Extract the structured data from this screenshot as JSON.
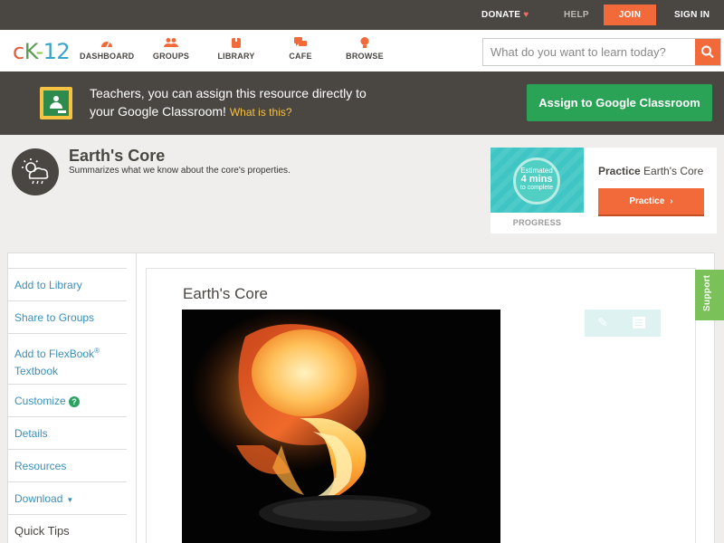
{
  "topbar": {
    "donate": "DONATE",
    "help": "HELP",
    "join": "JOIN",
    "sign_in": "SIGN IN"
  },
  "logo": {
    "c": "c",
    "k": "K",
    "dash": "-",
    "n": "12"
  },
  "nav": {
    "items": [
      {
        "label": "DASHBOARD",
        "icon": "dashboard-icon"
      },
      {
        "label": "GROUPS",
        "icon": "groups-icon"
      },
      {
        "label": "LIBRARY",
        "icon": "library-icon"
      },
      {
        "label": "CAFE",
        "icon": "cafe-icon"
      },
      {
        "label": "BROWSE",
        "icon": "browse-icon"
      }
    ],
    "search_placeholder": "What do you want to learn today?"
  },
  "banner": {
    "text_line1": "Teachers, you can assign this resource directly to",
    "text_line2": "your Google Classroom!",
    "what_link": "What is this?",
    "assign_button": "Assign to Google Classroom"
  },
  "concept": {
    "title": "Earth's Core",
    "subtitle": "Summarizes what we know about the core's properties."
  },
  "practice": {
    "estimated": "Estimated",
    "minutes": "4 mins",
    "to_complete": "to complete",
    "progress_label": "PROGRESS",
    "title_bold": "Practice",
    "title_rest": " Earth's Core",
    "button": "Practice"
  },
  "sidebar": {
    "add_library": "Add to Library",
    "share_groups": "Share to Groups",
    "add_flexbook_1": "Add to FlexBook",
    "add_flexbook_reg": "®",
    "add_flexbook_2": "Textbook",
    "customize": "Customize",
    "customize_badge": "?",
    "details": "Details",
    "resources": "Resources",
    "download": "Download",
    "quick_tips": "Quick Tips"
  },
  "lesson": {
    "title": "Earth's Core"
  },
  "support": "Support",
  "colors": {
    "accent_orange": "#f26a3a",
    "dark_bar": "#4a4642",
    "assign_green": "#2ba357",
    "link_blue": "#3a8fb7",
    "support_green": "#7ac15a"
  }
}
